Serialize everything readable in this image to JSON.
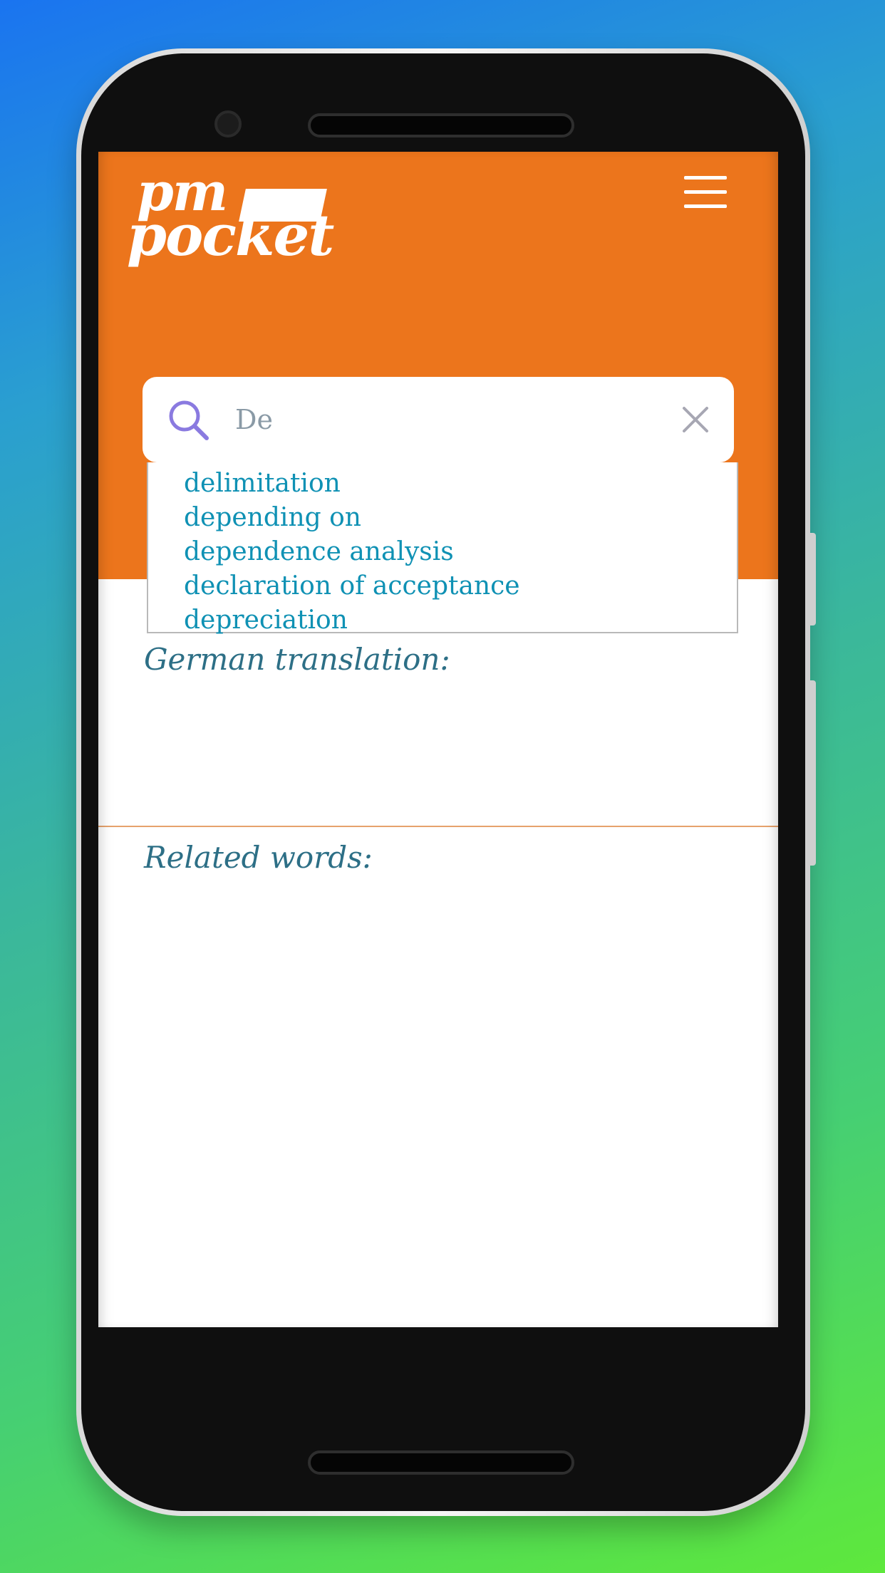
{
  "app": {
    "logo_line1": "pm",
    "logo_line2": "pocket",
    "menu_icon": "hamburger-menu-icon",
    "brand_color": "#ec751c"
  },
  "search": {
    "value": "De",
    "icon": "search-icon",
    "clear_icon": "close-icon"
  },
  "suggestions": [
    "delimitation",
    "depending on",
    "dependence analysis",
    "declaration of acceptance",
    "depreciation"
  ],
  "sections": {
    "translation_label": "German translation:",
    "related_label": "Related words:"
  }
}
